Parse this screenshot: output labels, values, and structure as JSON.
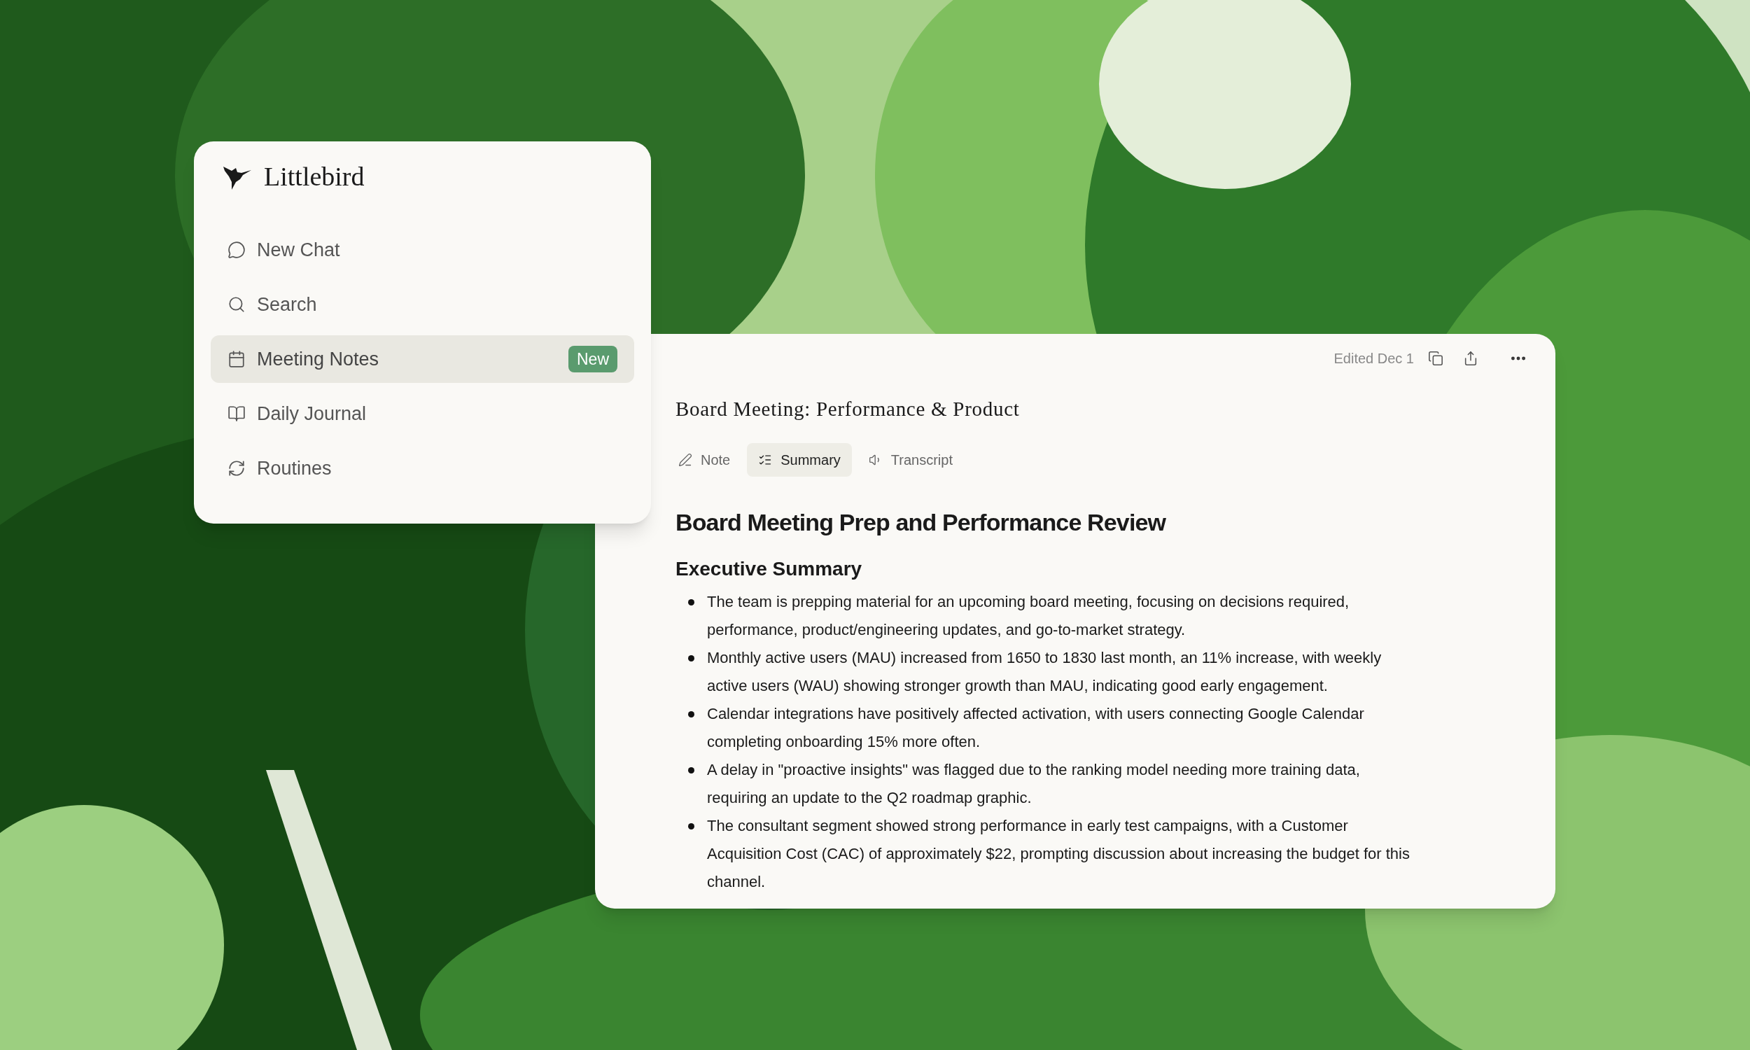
{
  "sidebar": {
    "brand": "Littlebird",
    "items": [
      {
        "label": "New Chat",
        "selected": false
      },
      {
        "label": "Search",
        "selected": false
      },
      {
        "label": "Meeting Notes",
        "selected": true,
        "badge": "New"
      },
      {
        "label": "Daily Journal",
        "selected": false
      },
      {
        "label": "Routines",
        "selected": false
      }
    ]
  },
  "document": {
    "edited": "Edited Dec 1",
    "title": "Board Meeting: Performance & Product",
    "tabs": [
      {
        "label": "Note",
        "selected": false
      },
      {
        "label": "Summary",
        "selected": true
      },
      {
        "label": "Transcript",
        "selected": false
      }
    ],
    "heading": "Board Meeting Prep and Performance Review",
    "section": "Executive Summary",
    "bullets": [
      "The team is prepping material for an upcoming board meeting, focusing on decisions required, performance, product/engineering updates, and go-to-market strategy.",
      "Monthly active users (MAU) increased from 1650 to 1830 last month, an 11% increase, with weekly active users (WAU) showing stronger growth than MAU, indicating good early engagement.",
      "Calendar integrations have positively affected activation, with users connecting Google Calendar completing onboarding 15% more often.",
      "A delay in \"proactive insights\" was flagged due to the ranking model needing more training data, requiring an update to the Q2 roadmap graphic.",
      "The consultant segment showed strong performance in early test campaigns, with a Customer Acquisition Cost (CAC) of approximately $22, prompting discussion about increasing the budget for this channel."
    ]
  }
}
